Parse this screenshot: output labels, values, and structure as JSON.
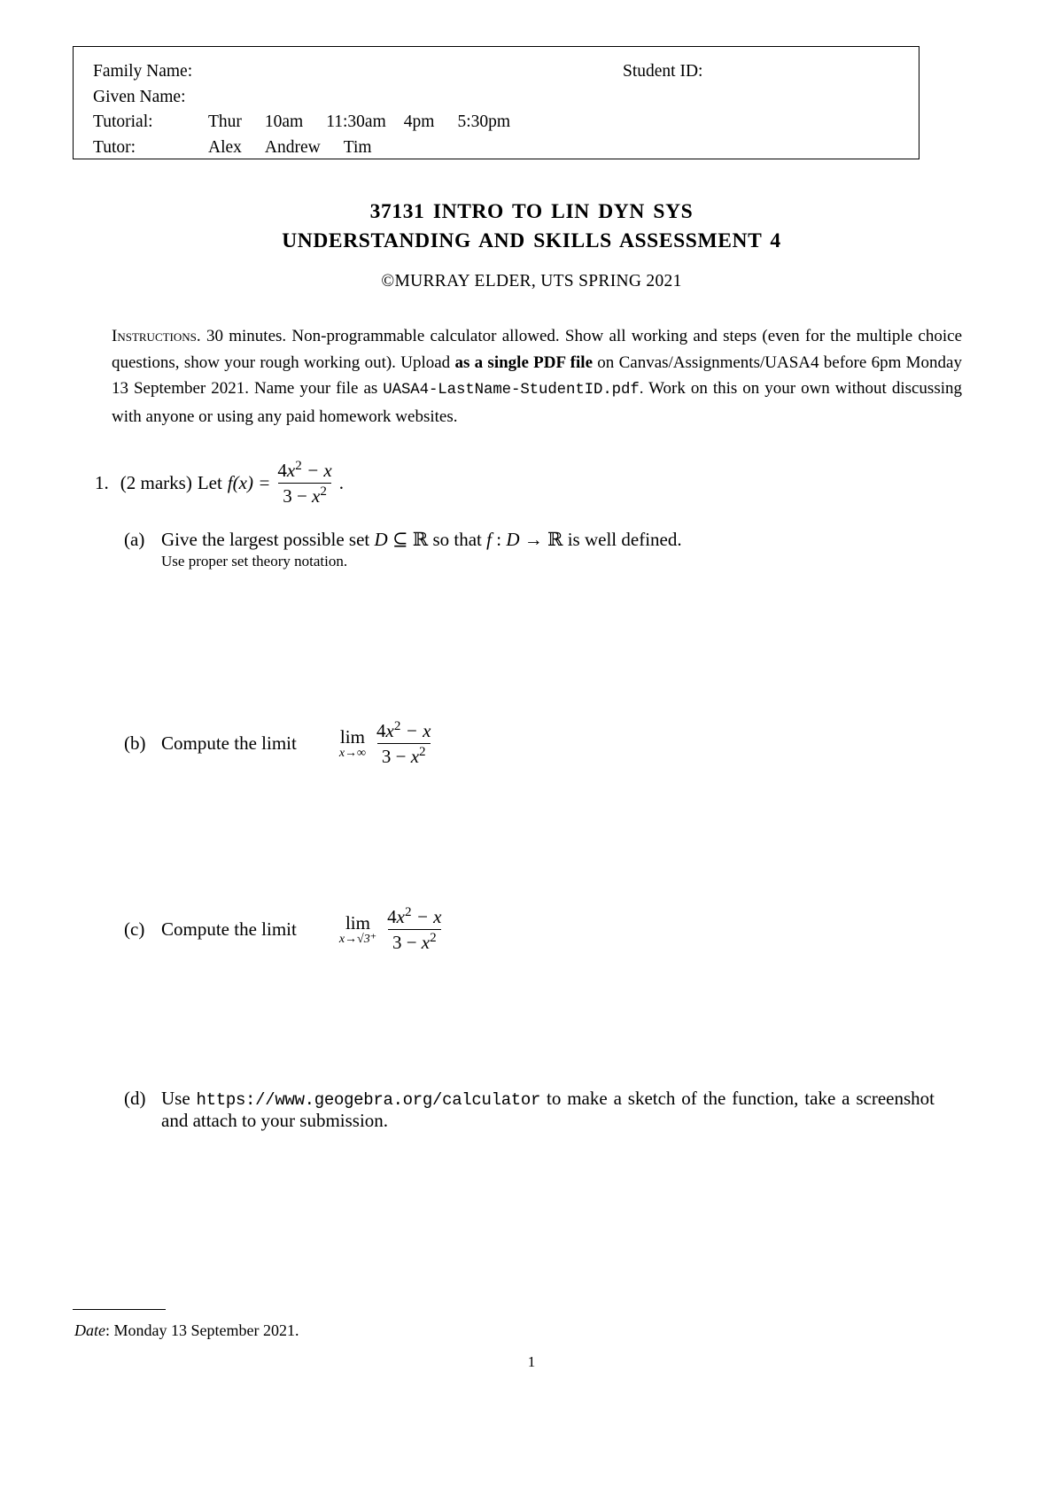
{
  "header_box": {
    "family_name_label": "Family Name:",
    "given_name_label": "Given Name:",
    "student_id_label": "Student ID:",
    "tutorial_label": "Tutorial:",
    "tutorial_options": [
      "Thur",
      "10am",
      "11:30am",
      "4pm",
      "5:30pm"
    ],
    "tutor_label": "Tutor:",
    "tutor_options": [
      "Alex",
      "Andrew",
      "Tim"
    ]
  },
  "title": {
    "line1": "37131 INTRO TO LIN DYN SYS",
    "line2": "UNDERSTANDING AND SKILLS ASSESSMENT 4",
    "copyright": "©MURRAY ELDER, UTS SPRING 2021"
  },
  "instructions": {
    "heading": "Instructions.",
    "text_part1": " 30 minutes. Non-programmable calculator allowed. Show all working and steps (even for the multiple choice questions, show your rough working out). Upload ",
    "bold_phrase": "as a single PDF file",
    "text_part2": " on Canvas/Assignments/UASA4 before 6pm Monday 13 September 2021. Name your file as ",
    "filename": "UASA4-LastName-StudentID.pdf",
    "text_part3": ". Work on this on your own without discussing with anyone or using any paid homework websites."
  },
  "question1": {
    "number": "1.",
    "marks": "(2 marks)",
    "lead": "Let",
    "fn_name": "f",
    "fn_arg": "(x) =",
    "numerator": "4x² − x",
    "denominator": "3 − x²",
    "numerator_coeff": "4",
    "numerator_var": "x",
    "numerator_exp": "2",
    "numerator_rest": "− x",
    "denominator_const": "3 − ",
    "denominator_var": "x",
    "denominator_exp": "2",
    "period": ".",
    "parts": [
      {
        "label": "(a)",
        "text": "Give the largest possible set D ⊆ ℝ so that f : D → ℝ is well defined.",
        "text_pre_D": "Give the largest possible set ",
        "D1": "D",
        "subset": " ⊆ ",
        "R1": "ℝ",
        "mid": " so that ",
        "f": "f",
        "colon": " : ",
        "D2": "D",
        "arrow": " → ",
        "R2": "ℝ",
        "post": " is well defined.",
        "hint": "Use proper set theory notation."
      },
      {
        "label": "(b)",
        "text": "Compute the limit",
        "lim": "lim",
        "lim_sub": "x→∞"
      },
      {
        "label": "(c)",
        "text": "Compute the limit",
        "lim": "lim",
        "lim_sub": "x→√3⁺"
      },
      {
        "label": "(d)",
        "text_pre": "Use ",
        "url": "https://www.geogebra.org/calculator",
        "text_post": " to make a sketch of the function, take a screenshot and attach to your submission."
      }
    ]
  },
  "footer": {
    "date_label": "Date",
    "date_value": ": Monday 13 September 2021.",
    "page_number": "1"
  }
}
